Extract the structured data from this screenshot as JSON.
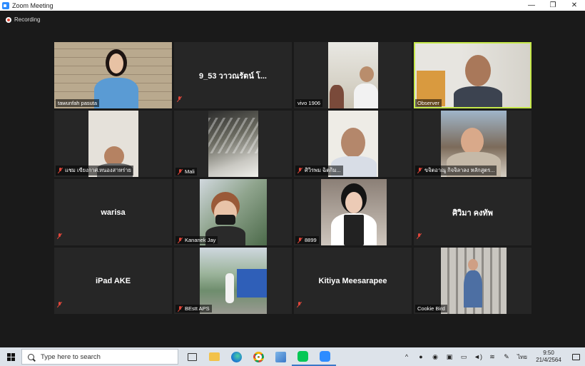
{
  "window": {
    "title": "Zoom Meeting",
    "controls": {
      "minimize": "—",
      "maximize": "❐",
      "close": "✕"
    }
  },
  "recording": {
    "label": "Recording"
  },
  "participants": [
    {
      "id": "p1",
      "name": "tawunfah pasuta",
      "muted": false,
      "video": true
    },
    {
      "id": "p2",
      "name": "9_53 วาวณรัตน์ โ...",
      "muted": true,
      "video": false,
      "label": ""
    },
    {
      "id": "p3",
      "name": "vivo 1906",
      "muted": false,
      "video": true
    },
    {
      "id": "p4",
      "name": "Observer",
      "muted": false,
      "video": true,
      "active": true
    },
    {
      "id": "p5",
      "name": "แชม เขียงกาศ.หนองสาหร่าย",
      "muted": true,
      "video": true
    },
    {
      "id": "p6",
      "name": "Mali",
      "muted": true,
      "video": true
    },
    {
      "id": "p7",
      "name": "ศิวิรพม ฉิตกิม...",
      "muted": true,
      "video": true
    },
    {
      "id": "p8",
      "name": "ขจิตอาณู กิจจิลาลง หลักสูตร...",
      "muted": true,
      "video": true
    },
    {
      "id": "p9",
      "name": "warisa",
      "muted": true,
      "video": false
    },
    {
      "id": "p10",
      "name": "Kananek Jay",
      "muted": true,
      "video": true
    },
    {
      "id": "p11",
      "name": "8899",
      "muted": true,
      "video": true
    },
    {
      "id": "p12",
      "name": "ศิวิมา คงทัพ",
      "muted": true,
      "video": false
    },
    {
      "id": "p13",
      "name": "iPad AKE",
      "muted": true,
      "video": false
    },
    {
      "id": "p14",
      "name": "BEstt APS",
      "muted": true,
      "video": true
    },
    {
      "id": "p15",
      "name": "Kitiya Meesarapee",
      "muted": true,
      "video": false
    },
    {
      "id": "p16",
      "name": "Cookie Bird",
      "muted": false,
      "video": true
    }
  ],
  "taskbar": {
    "search_placeholder": "Type here to search",
    "apps": [
      "task-view",
      "file-explorer",
      "edge",
      "chrome",
      "files",
      "line",
      "zoom"
    ],
    "tray": {
      "chevron": "^",
      "language": "ไทย",
      "time": "9:50",
      "date": "21/4/2564"
    }
  },
  "colors": {
    "active_speaker_border": "#c6e84a",
    "muted_icon": "#e0463a",
    "tile_bg": "#262626",
    "meeting_bg": "#1a1a1a"
  }
}
